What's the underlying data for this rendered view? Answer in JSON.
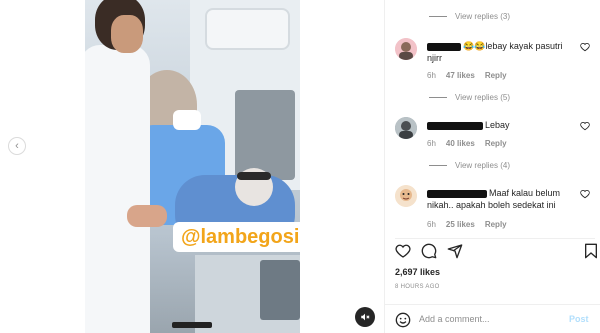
{
  "media": {
    "watermark": "@lambegosiip"
  },
  "comments": {
    "view_replies_1": "View replies (3)",
    "items": [
      {
        "text_visible": "😂😂lebay kayak pasutri njirr",
        "time": "6h",
        "likes": "47 likes",
        "reply": "Reply",
        "avatar_color": "#f2c2c8"
      },
      {
        "text_visible": "Lebay",
        "time": "6h",
        "likes": "40 likes",
        "reply": "Reply",
        "avatar_color": "#9aa7ad"
      },
      {
        "text_visible": "Maaf kalau belum nikah.. apakah boleh sedekat ini",
        "time": "6h",
        "likes": "25 likes",
        "reply": "Reply",
        "avatar_color": "#f5e2cc"
      }
    ],
    "view_replies_2": "View replies (5)",
    "view_replies_3": "View replies (4)"
  },
  "actions": {
    "likes": "2,697 likes",
    "time": "8 HOURS AGO"
  },
  "add_comment": {
    "placeholder": "Add a comment...",
    "post_label": "Post"
  },
  "icons": {
    "like": "heart-icon",
    "comment": "comment-icon",
    "share": "share-icon",
    "save": "bookmark-icon",
    "emoji": "smiley-icon",
    "mute": "speaker-muted-icon",
    "prev": "chevron-left-icon"
  },
  "colors": {
    "watermark_text": "#f2a51a",
    "post_disabled": "#b2dffc",
    "muted_text": "#8e8e8e"
  }
}
